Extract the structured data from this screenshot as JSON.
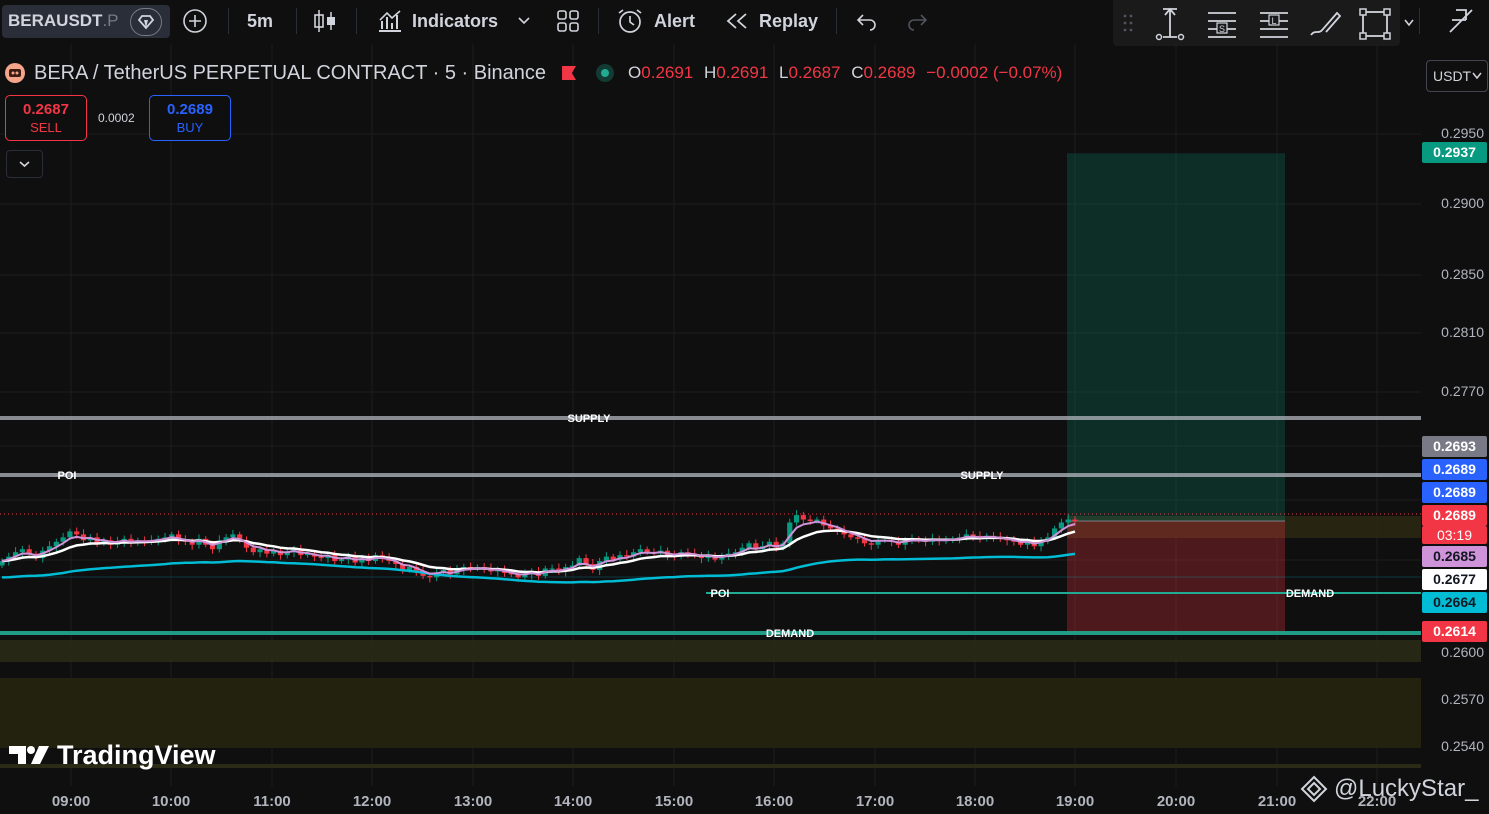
{
  "toolbar": {
    "symbol": "BERAUSDT",
    "symbol_suffix": ".P",
    "interval": "5m",
    "indicators_label": "Indicators",
    "alert_label": "Alert",
    "replay_label": "Replay"
  },
  "legend": {
    "title": "BERA / TetherUS PERPETUAL CONTRACT · 5 · Binance",
    "o_label": "O",
    "o_value": "0.2691",
    "h_label": "H",
    "h_value": "0.2691",
    "l_label": "L",
    "l_value": "0.2687",
    "c_label": "C",
    "c_value": "0.2689",
    "change": "−0.0002 (−0.07%)"
  },
  "trade": {
    "sell_price": "0.2687",
    "sell_label": "SELL",
    "spread": "0.0002",
    "buy_price": "0.2689",
    "buy_label": "BUY"
  },
  "currency": "USDT",
  "price_axis": {
    "labels": [
      "0.2950",
      "0.2900",
      "0.2850",
      "0.2810",
      "0.2770",
      "0.2600",
      "0.2570",
      "0.2540"
    ],
    "tags": [
      {
        "text": "0.2937",
        "bg": "#089981",
        "fg": "#ffffff"
      },
      {
        "text": "0.2693",
        "bg": "#787b86",
        "fg": "#ffffff"
      },
      {
        "text": "0.2689",
        "bg": "#2962ff",
        "fg": "#ffffff"
      },
      {
        "text": "0.2689",
        "bg": "#2962ff",
        "fg": "#ffffff"
      },
      {
        "text": "0.2689",
        "bg": "#f23645",
        "fg": "#ffffff"
      },
      {
        "text": "03:19",
        "bg": "#f23645",
        "fg": "#ffffff"
      },
      {
        "text": "0.2685",
        "bg": "#ce93d8",
        "fg": "#131722"
      },
      {
        "text": "0.2677",
        "bg": "#ffffff",
        "fg": "#131722"
      },
      {
        "text": "0.2664",
        "bg": "#00bcd4",
        "fg": "#131722"
      },
      {
        "text": "0.2614",
        "bg": "#f23645",
        "fg": "#ffffff"
      }
    ]
  },
  "time_axis": [
    "09:00",
    "10:00",
    "11:00",
    "12:00",
    "13:00",
    "14:00",
    "15:00",
    "16:00",
    "17:00",
    "18:00",
    "19:00",
    "20:00",
    "21:00",
    "22:00"
  ],
  "annotations": {
    "supply_upper": "SUPPLY",
    "supply_lower": "SUPPLY",
    "poi_left": "POI",
    "poi_mid": "POI",
    "demand_right": "DEMAND",
    "demand_main": "DEMAND"
  },
  "branding": {
    "logo_text": "TradingView",
    "watermark": "@LuckyStar_"
  },
  "chart_data": {
    "type": "candlestick",
    "ylim": [
      0.2525,
      0.2975
    ],
    "ema_colors": {
      "fast": "#ce93d8",
      "mid": "#ffffff",
      "slow": "#00bcd4"
    },
    "position": {
      "type": "long",
      "entry": 0.2689,
      "target": 0.2937,
      "stop": 0.2614
    },
    "levels": [
      {
        "name": "SUPPLY",
        "price": 0.2725
      },
      {
        "name": "SUPPLY",
        "price": 0.2693
      },
      {
        "name": "POI",
        "price": 0.2659
      },
      {
        "name": "DEMAND",
        "price": 0.2614
      }
    ],
    "candles_close": [
      0.2662,
      0.2665,
      0.2668,
      0.267,
      0.2667,
      0.2664,
      0.2669,
      0.2672,
      0.2675,
      0.2678,
      0.2682,
      0.268,
      0.2676,
      0.2678,
      0.2674,
      0.2676,
      0.2673,
      0.2675,
      0.2677,
      0.2674,
      0.2676,
      0.2675,
      0.2676,
      0.2677,
      0.2678,
      0.268,
      0.2676,
      0.2675,
      0.2673,
      0.2677,
      0.2673,
      0.267,
      0.2676,
      0.2678,
      0.268,
      0.2676,
      0.2671,
      0.2668,
      0.267,
      0.2667,
      0.2669,
      0.2666,
      0.2668,
      0.267,
      0.2666,
      0.2667,
      0.2665,
      0.2664,
      0.2666,
      0.2662,
      0.2663,
      0.2665,
      0.2661,
      0.2664,
      0.2662,
      0.2666,
      0.2664,
      0.2662,
      0.266,
      0.2656,
      0.2658,
      0.2655,
      0.2652,
      0.2651,
      0.2654,
      0.2656,
      0.2653,
      0.2656,
      0.2658,
      0.2657,
      0.2658,
      0.2657,
      0.2655,
      0.2656,
      0.2654,
      0.2653,
      0.2651,
      0.2653,
      0.2655,
      0.2652,
      0.2657,
      0.2657,
      0.2655,
      0.2658,
      0.2659,
      0.2664,
      0.266,
      0.2656,
      0.2662,
      0.2665,
      0.2663,
      0.2666,
      0.2665,
      0.2668,
      0.267,
      0.2668,
      0.2667,
      0.2669,
      0.2666,
      0.2665,
      0.2668,
      0.2667,
      0.2666,
      0.2664,
      0.2666,
      0.2663,
      0.2665,
      0.2667,
      0.2668,
      0.2671,
      0.2674,
      0.267,
      0.2672,
      0.2675,
      0.2671,
      0.2674,
      0.2688,
      0.2693,
      0.269,
      0.2689,
      0.269,
      0.2686,
      0.2684,
      0.2683,
      0.268,
      0.2678,
      0.2677,
      0.2674,
      0.2673,
      0.2676,
      0.2676,
      0.2675,
      0.2673,
      0.2676,
      0.2677,
      0.2676,
      0.2675,
      0.2677,
      0.2676,
      0.2676,
      0.2677,
      0.2678,
      0.268,
      0.2679,
      0.2677,
      0.2679,
      0.2678,
      0.2677,
      0.2676,
      0.2675,
      0.2673,
      0.2675,
      0.2672,
      0.2676,
      0.2678,
      0.2684,
      0.2688,
      0.269,
      0.2689
    ]
  }
}
